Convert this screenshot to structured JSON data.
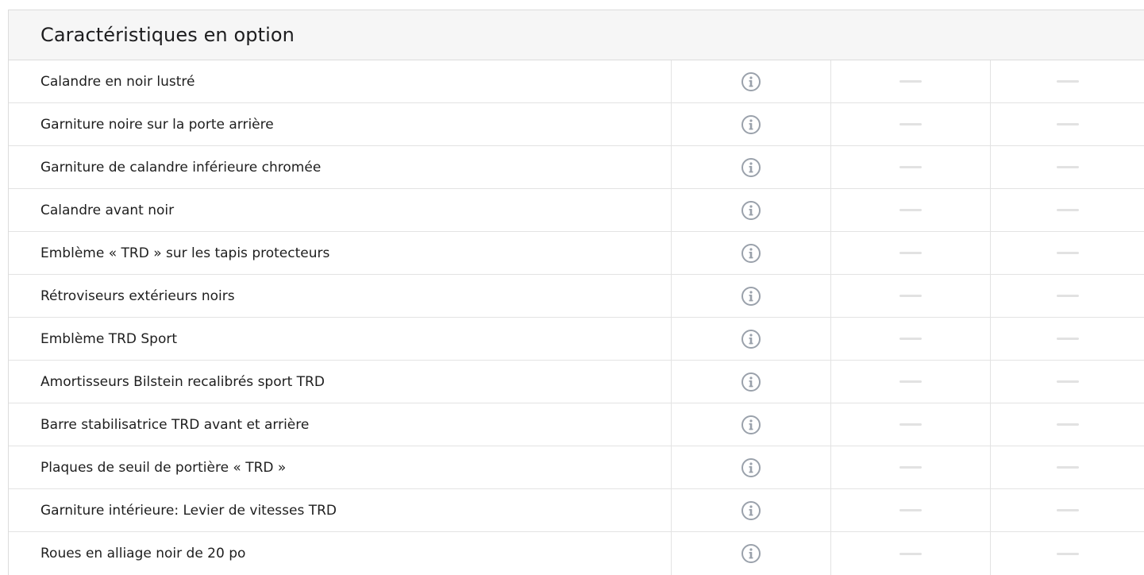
{
  "section": {
    "title": "Caractéristiques en option"
  },
  "colors": {
    "info_icon": "#9aa1ab",
    "dash": "#e2e2e2",
    "border": "#e3e3e3",
    "header_bg": "#f6f6f6"
  },
  "icons": {
    "info": "info-circle-icon",
    "unavailable": "dash-icon"
  },
  "rows": [
    {
      "label": "Calandre en noir lustré"
    },
    {
      "label": "Garniture noire sur la porte arrière"
    },
    {
      "label": "Garniture de calandre inférieure chromée"
    },
    {
      "label": "Calandre avant noir"
    },
    {
      "label": "Emblème « TRD » sur les tapis protecteurs"
    },
    {
      "label": "Rétroviseurs extérieurs noirs"
    },
    {
      "label": "Emblème TRD Sport"
    },
    {
      "label": "Amortisseurs Bilstein recalibrés sport TRD"
    },
    {
      "label": "Barre stabilisatrice TRD avant et arrière"
    },
    {
      "label": "Plaques de seuil de portière « TRD »"
    },
    {
      "label": "Garniture intérieure: Levier de vitesses TRD"
    },
    {
      "label": "Roues en alliage noir de 20 po"
    }
  ]
}
